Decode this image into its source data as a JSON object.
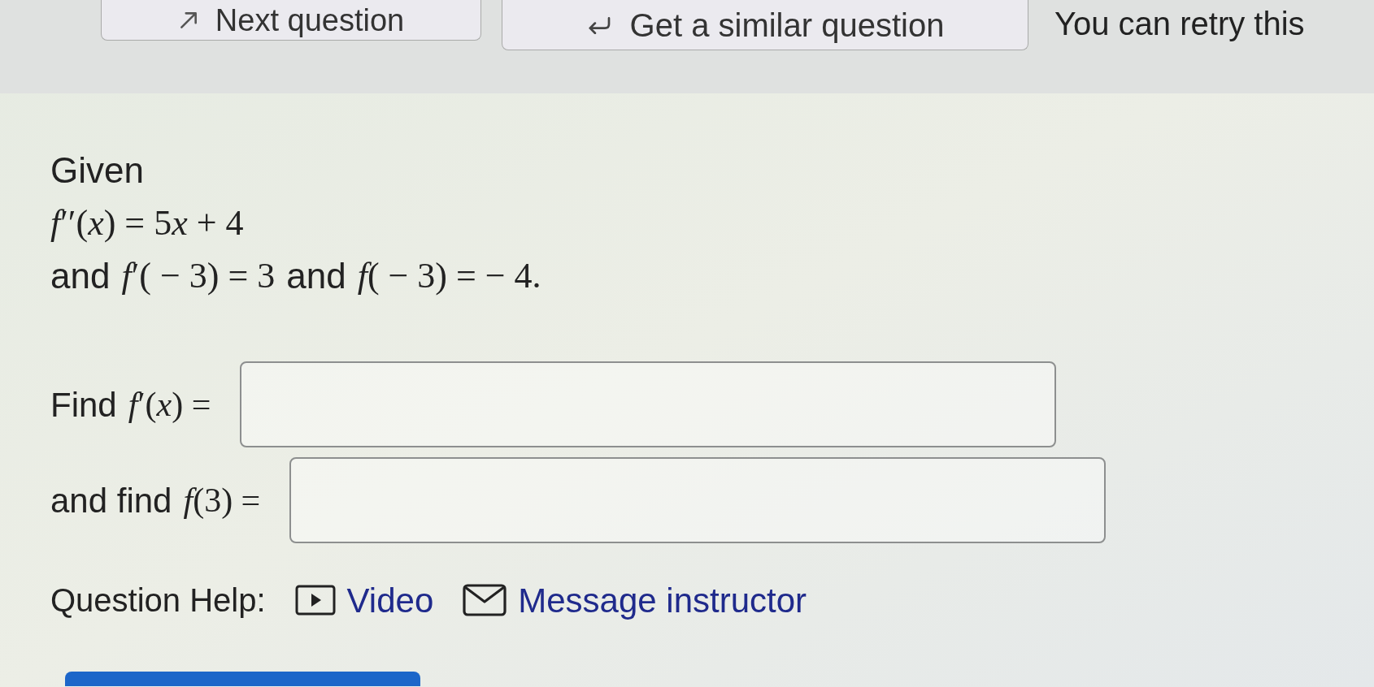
{
  "toolbar": {
    "buttons": [
      {
        "kind": "next",
        "label": "Next question"
      },
      {
        "kind": "similar",
        "label": "Get a similar question"
      }
    ],
    "note": "You can retry this"
  },
  "question": {
    "lines": [
      [
        {
          "kind": "text",
          "text": "Given"
        }
      ],
      [
        {
          "kind": "math",
          "text": "f′′(x) = 5x + 4"
        }
      ],
      [
        {
          "kind": "text",
          "text": "and"
        },
        {
          "kind": "math",
          "text": "f′( − 3) = 3"
        },
        {
          "kind": "text",
          "text": "and"
        },
        {
          "kind": "math",
          "text": "f( − 3) = − 4."
        }
      ]
    ]
  },
  "answers": [
    {
      "prompt": [
        {
          "kind": "text",
          "text": "Find"
        },
        {
          "kind": "math",
          "text": "f′(x) ="
        }
      ]
    },
    {
      "prompt": [
        {
          "kind": "text",
          "text": "and find"
        },
        {
          "kind": "math",
          "text": "f(3) ="
        }
      ]
    }
  ],
  "help": {
    "label": "Question Help:",
    "links": [
      {
        "kind": "video",
        "label": "Video"
      },
      {
        "kind": "message",
        "label": "Message instructor"
      }
    ]
  }
}
